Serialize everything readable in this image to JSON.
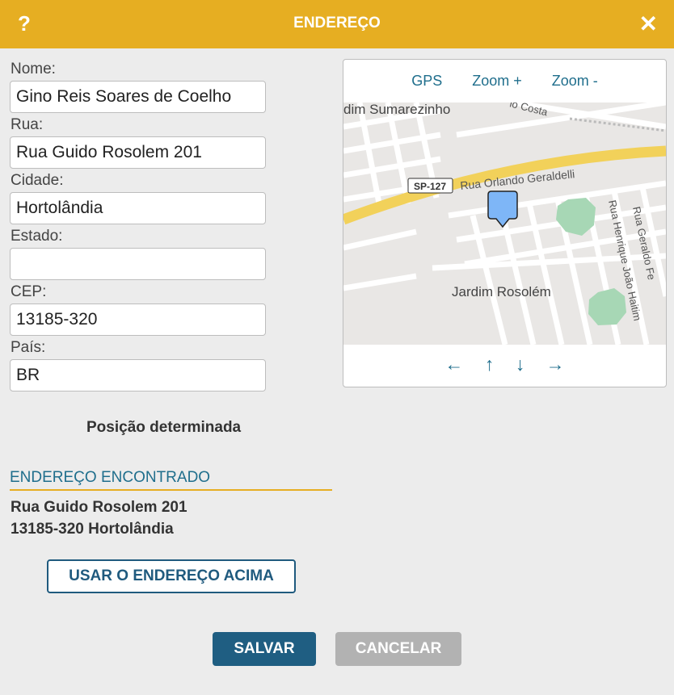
{
  "dialog": {
    "title": "ENDEREÇO",
    "help_label": "?",
    "close_label": "✕"
  },
  "form": {
    "nome": {
      "label": "Nome:",
      "value": "Gino Reis Soares de Coelho"
    },
    "rua": {
      "label": "Rua:",
      "value": "Rua Guido Rosolem 201"
    },
    "cidade": {
      "label": "Cidade:",
      "value": "Hortolândia"
    },
    "estado": {
      "label": "Estado:",
      "value": ""
    },
    "cep": {
      "label": "CEP:",
      "value": "13185-320"
    },
    "pais": {
      "label": "País:",
      "value": "BR"
    }
  },
  "map": {
    "controls": {
      "gps": "GPS",
      "zoom_in": "Zoom +",
      "zoom_out": "Zoom -"
    },
    "arrows": {
      "left": "←",
      "up": "↑",
      "down": "↓",
      "right": "→"
    },
    "labels": {
      "top_left": "dim Sumarezinho",
      "top_road": "io Costa",
      "highway_shield": "SP-127",
      "highway_road": "Rua Orlando Geraldelli",
      "district": "Jardim Rosolém",
      "road_v1": "Rua Henrique João Haitim",
      "road_v2": "Rua Geraldo Fe"
    },
    "colors": {
      "highway": "#f2d15a",
      "park": "#a7d7b5",
      "marker": "#7eb6f7",
      "water": "#9fd4e8"
    }
  },
  "status_text": "Posição determinada",
  "found": {
    "title": "ENDEREÇO ENCONTRADO",
    "line1": "Rua Guido Rosolem 201",
    "line2": "13185-320 Hortolândia"
  },
  "buttons": {
    "use_address": "USAR O ENDEREÇO ACIMA",
    "save": "SALVAR",
    "cancel": "CANCELAR"
  },
  "colors": {
    "header": "#e6ae22",
    "accent": "#1f6e8c",
    "primary_button": "#1f5e82",
    "disabled_button": "#b2b2b2"
  }
}
